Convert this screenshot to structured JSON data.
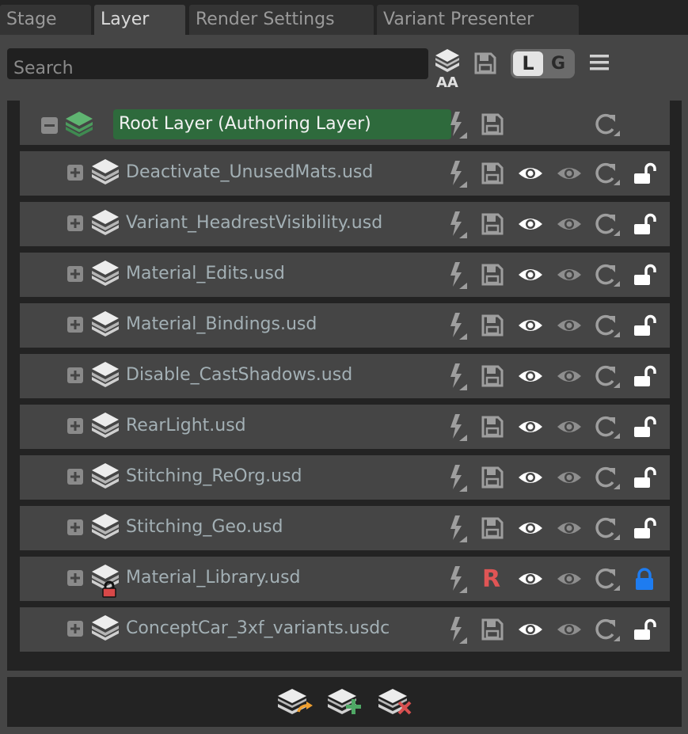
{
  "tabs": [
    {
      "label": "Stage",
      "active": false
    },
    {
      "label": "Layer",
      "active": true
    },
    {
      "label": "Render Settings",
      "active": false
    },
    {
      "label": "Variant Presenter",
      "active": false
    }
  ],
  "toolbar": {
    "search_placeholder": "Search",
    "aa_label": "AA",
    "toggle_l": "L",
    "toggle_g": "G"
  },
  "root": {
    "label": "Root Layer (Authoring Layer)",
    "expanded": true
  },
  "layers": [
    {
      "name": "Deactivate_UnusedMats.usd",
      "status": "save",
      "locked": false
    },
    {
      "name": "Variant_HeadrestVisibility.usd",
      "status": "save",
      "locked": false
    },
    {
      "name": "Material_Edits.usd",
      "status": "save",
      "locked": false
    },
    {
      "name": "Material_Bindings.usd",
      "status": "save",
      "locked": false
    },
    {
      "name": "Disable_CastShadows.usd",
      "status": "save",
      "locked": false
    },
    {
      "name": "RearLight.usd",
      "status": "save",
      "locked": false
    },
    {
      "name": "Stitching_ReOrg.usd",
      "status": "save",
      "locked": false
    },
    {
      "name": "Stitching_Geo.usd",
      "status": "save",
      "locked": false
    },
    {
      "name": "Material_Library.usd",
      "status": "readonly",
      "readonly_label": "R",
      "locked": true
    },
    {
      "name": "ConceptCar_3xf_variants.usdc",
      "status": "save",
      "locked": false
    }
  ],
  "colors": {
    "root_highlight": "#2e6a3c",
    "lock_locked": "#1e7cf0",
    "readonly_r": "#e05555",
    "layer_badge_lock": "#e05555"
  },
  "footer": {
    "actions": [
      "insert-sublayer-icon",
      "create-sublayer-icon",
      "remove-sublayer-icon"
    ]
  }
}
